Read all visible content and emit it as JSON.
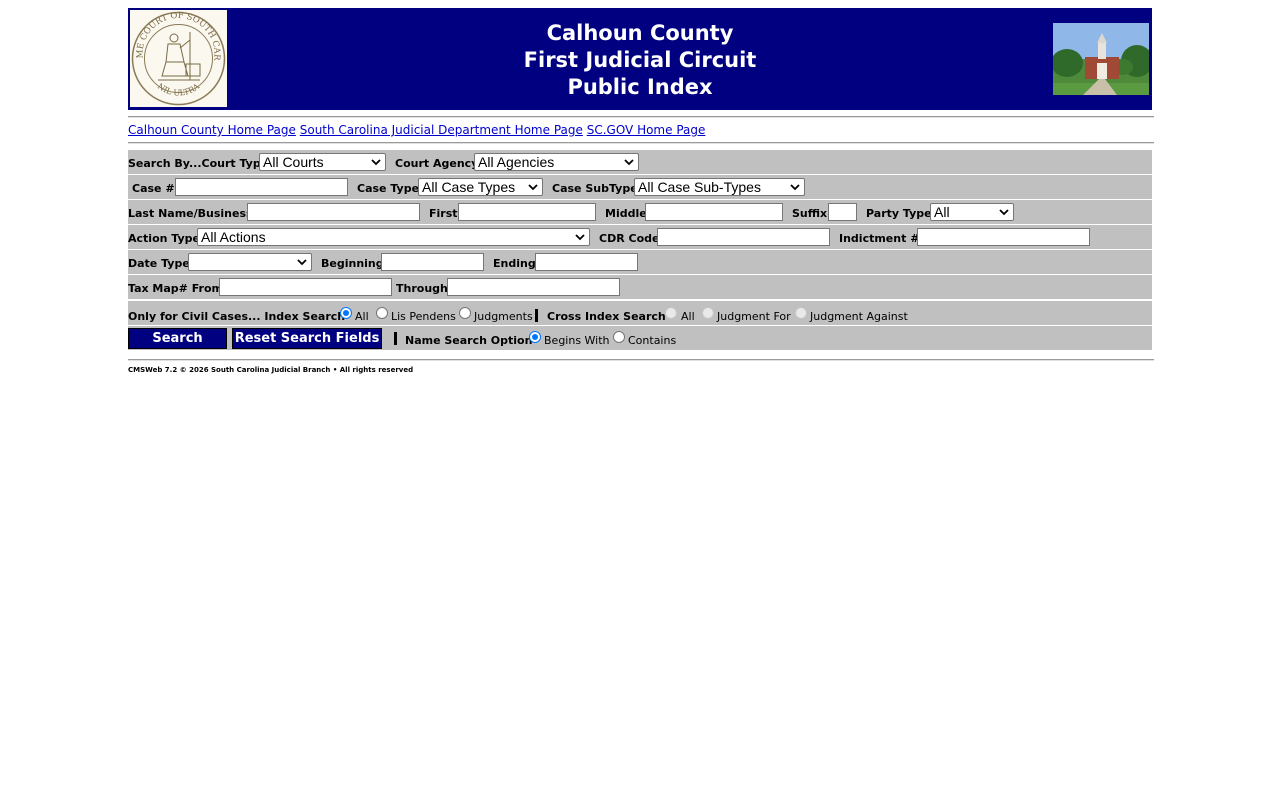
{
  "header": {
    "title_lines": [
      "Calhoun County",
      "First Judicial Circuit",
      "Public Index"
    ],
    "seal_text_top": "SUPREME COURT OF SOUTH CAROLINA",
    "seal_text_bottom": "NIL ULTRA"
  },
  "links": [
    "Calhoun County Home Page",
    "South Carolina Judicial Department Home Page",
    "SC.GOV Home Page"
  ],
  "form": {
    "search_by_court_type_label": "Search By...Court Type",
    "court_type_value": "All Courts",
    "court_agency_label": "Court Agency",
    "court_agency_value": "All Agencies",
    "case_number_label": "Case #",
    "case_number_value": "",
    "case_type_label": "Case Type",
    "case_type_value": "All Case Types",
    "case_subtype_label": "Case SubType",
    "case_subtype_value": "All Case Sub-Types",
    "last_name_label": "Last Name/Business",
    "first_label": "First",
    "middle_label": "Middle",
    "suffix_label": "Suffix",
    "party_type_label": "Party Type",
    "party_type_value": "All",
    "action_type_label": "Action Type",
    "action_type_value": "All Actions",
    "cdr_code_label": "CDR Code",
    "indictment_label": "Indictment #",
    "date_type_label": "Date Type",
    "date_type_value": "",
    "beginning_label": "Beginning",
    "ending_label": "Ending",
    "tax_map_from_label": "Tax Map# From",
    "through_label": "Through",
    "civil_only_label": "Only for Civil Cases... Index Search",
    "index_options": [
      "All",
      "Lis Pendens",
      "Judgments"
    ],
    "index_selected": "All",
    "cross_index_label": "Cross Index Search",
    "cross_options": [
      "All",
      "Judgment For",
      "Judgment Against"
    ],
    "search_button": "Search",
    "reset_button": "Reset Search Fields",
    "name_search_label": "Name Search Option",
    "name_options": [
      "Begins With",
      "Contains"
    ],
    "name_selected": "Begins With"
  },
  "footer": "CMSWeb 7.2 © 2026 South Carolina Judicial Branch • All rights reserved",
  "colors": {
    "banner": "#000080",
    "row_bg": "#c0c0c0",
    "link": "#0000cc",
    "radio_on": "#0075ff"
  }
}
